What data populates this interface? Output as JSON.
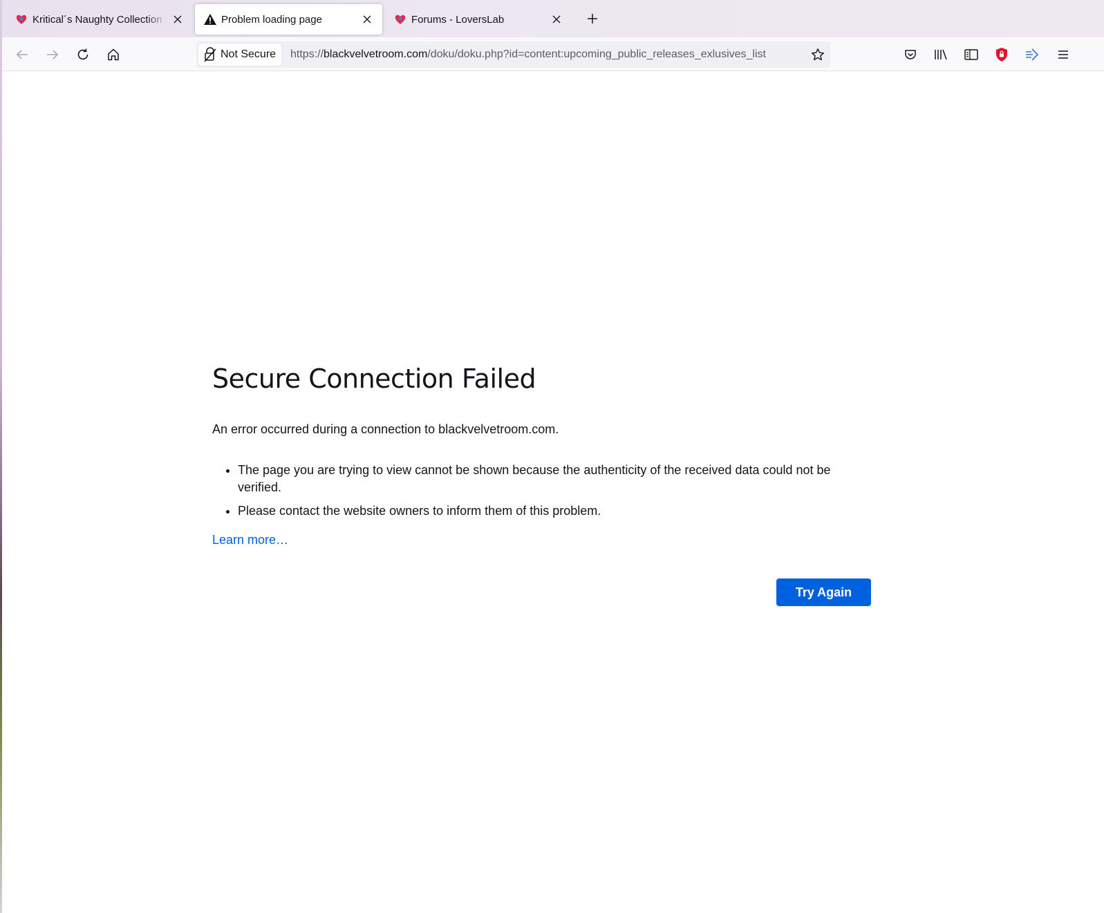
{
  "browser": {
    "tabs": [
      {
        "label": "Kritical´s Naughty Collection (LL",
        "icon": "heart-favicon-icon",
        "active": false
      },
      {
        "label": "Problem loading page",
        "icon": "warning-icon",
        "active": true
      },
      {
        "label": "Forums - LoversLab",
        "icon": "heart-favicon-icon",
        "active": false
      }
    ],
    "identity_label": "Not Secure",
    "url": {
      "scheme": "https://",
      "host": "blackvelvetroom.com",
      "path": "/doku/doku.php?id=content:upcoming_public_releases_exlusives_list"
    }
  },
  "error_page": {
    "title": "Secure Connection Failed",
    "description": "An error occurred during a connection to blackvelvetroom.com.",
    "bullets": [
      "The page you are trying to view cannot be shown because the authenticity of the received data could not be verified.",
      "Please contact the website owners to inform them of this problem."
    ],
    "learn_more": "Learn more…",
    "try_again": "Try Again"
  },
  "colors": {
    "accent": "#0061e0",
    "text": "#15141a",
    "url_muted": "#5b5b66",
    "ublock_red": "#e0152d"
  }
}
